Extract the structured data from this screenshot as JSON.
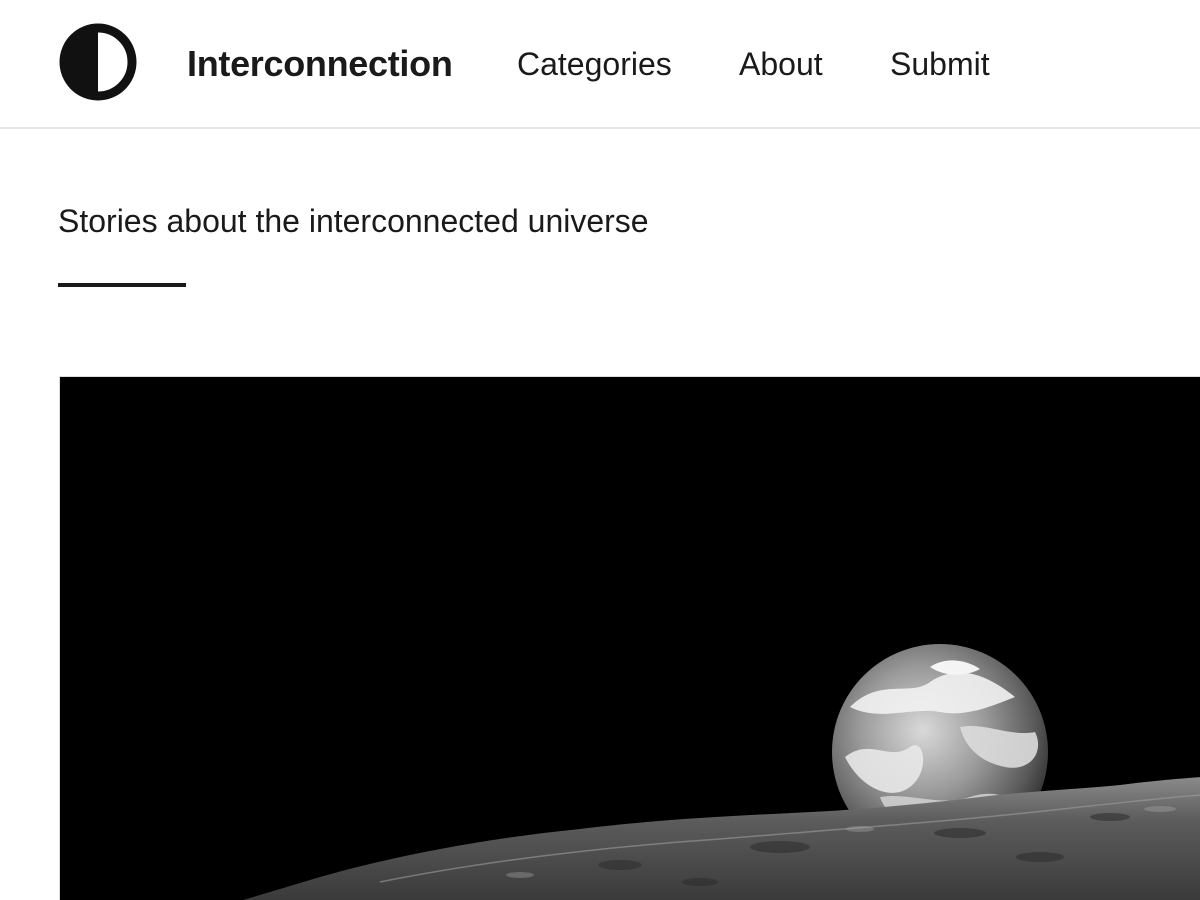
{
  "header": {
    "site_title": "Interconnection",
    "logo_icon": "half-circle-logo-icon",
    "nav": [
      {
        "label": "Categories"
      },
      {
        "label": "About"
      },
      {
        "label": "Submit"
      }
    ]
  },
  "main": {
    "tagline": "Stories about the interconnected universe",
    "hero_image": {
      "subject": "earthrise-photo"
    }
  },
  "colors": {
    "text": "#1a1a1a",
    "background": "#ffffff",
    "divider": "#e6e6e6"
  }
}
